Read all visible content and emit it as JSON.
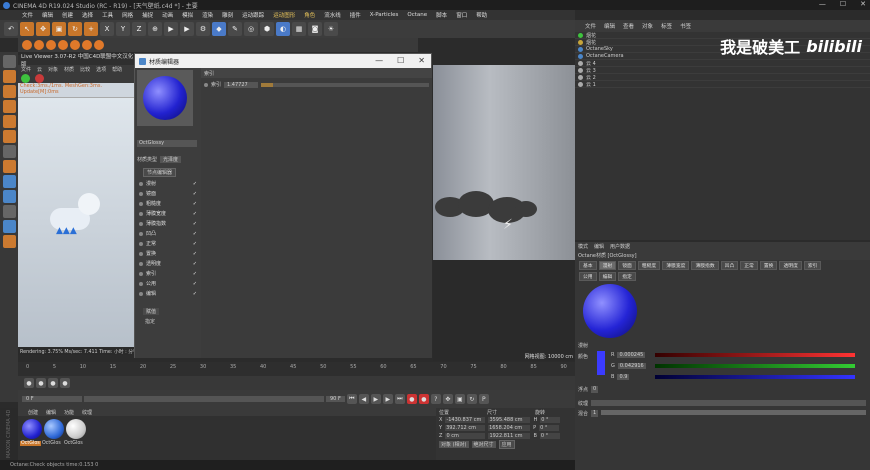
{
  "titlebar": {
    "title": "CINEMA 4D R19.024 Studio (RC - R19) - [天气壁纸.c4d *] - 主要"
  },
  "menubar": {
    "items": [
      "文件",
      "编辑",
      "创建",
      "选择",
      "工具",
      "网格",
      "捕捉",
      "动画",
      "模拟",
      "渲染",
      "雕刻",
      "运动跟踪",
      "运动图形",
      "角色",
      "流水线",
      "插件",
      "X-Particles",
      "Octane",
      "脚本",
      "窗口",
      "帮助"
    ]
  },
  "toolbar": {
    "xyz": [
      "X",
      "Y",
      "Z"
    ]
  },
  "viewer": {
    "title": "Live Viewer 3.07-R2 中国C4D联盟中文汉化版",
    "menus": [
      "文件",
      "云",
      "对象",
      "材质",
      "比较",
      "选项",
      "帮助"
    ],
    "message": "Check:3ms./1ms. MeshGen:3ms. Update[M]:0ms",
    "status": "Rendering: 3.75%   Ms/sec: 7.411   Time: 小时 : 分钟"
  },
  "render": {
    "label": "网格视图: 10000 cm"
  },
  "mat_editor": {
    "title": "材质编辑器",
    "material_name": "OctGlossy",
    "section": "索引",
    "index_label": "索引",
    "index_value": "1.47727",
    "material_type_label": "材质类型",
    "material_type_value": "光泽度",
    "node_button": "节点编辑器",
    "channels": [
      "漫射",
      "镜面",
      "粗糙度",
      "薄膜宽度",
      "薄膜指数",
      "凹凸",
      "正常",
      "置换",
      "透明度",
      "索引",
      "公用",
      "编辑"
    ],
    "assign": "赋值",
    "hint": "指定"
  },
  "objmgr": {
    "tabs": [
      "文件",
      "编辑",
      "查看",
      "对象",
      "标签",
      "书签"
    ],
    "rows": [
      {
        "name": "烟花",
        "color": "#3ec33e"
      },
      {
        "name": "烟花",
        "color": "#c7a53a"
      },
      {
        "name": "OctaneSky",
        "color": "#4b86c8"
      },
      {
        "name": "OctaneCamera",
        "color": "#4b86c8"
      },
      {
        "name": "云 4",
        "color": "#aaa"
      },
      {
        "name": "云 3",
        "color": "#aaa"
      },
      {
        "name": "云 2",
        "color": "#aaa"
      },
      {
        "name": "云 1",
        "color": "#aaa"
      }
    ],
    "logo_text": "我是破美工",
    "logo_brand": "bilibili"
  },
  "attr": {
    "tabs": [
      "模式",
      "编辑",
      "用户数据"
    ],
    "material": "Octane材质 [OctGlossy]",
    "chips_row1": [
      "基本",
      "漫射",
      "镜面",
      "粗糙度",
      "薄膜宽度",
      "薄膜指数",
      "凹凸",
      "正常",
      "置换",
      "透明度",
      "索引"
    ],
    "chips_row2": [
      "公用",
      "编辑",
      "指定"
    ],
    "section": "漫射",
    "color_label": "颜色",
    "r_label": "R",
    "r_value": "0.000245",
    "g_label": "G",
    "g_value": "0.042916",
    "b_label": "B",
    "b_value": "0.9",
    "float_label": "浮点",
    "float_value": "0",
    "texture_label": "纹理",
    "mix_label": "混合",
    "mix_value": "1"
  },
  "timeline": {
    "ticks": [
      "0",
      "5",
      "10",
      "15",
      "20",
      "25",
      "30",
      "35",
      "40",
      "45",
      "50",
      "55",
      "60",
      "65",
      "70",
      "75",
      "80",
      "85",
      "90"
    ],
    "start": "0 F",
    "end": "90 F"
  },
  "matmgr": {
    "tabs": [
      "创建",
      "编辑",
      "功能",
      "纹理"
    ],
    "materials": [
      "OctGlos",
      "OctGlos",
      "OctGlos"
    ]
  },
  "coord": {
    "headers": [
      "位置",
      "尺寸",
      "旋转"
    ],
    "rows": [
      {
        "axis": "X",
        "pos": "-1430.837 cm",
        "size": "3595.488 cm",
        "rotLabel": "H",
        "rot": "0 °"
      },
      {
        "axis": "Y",
        "pos": "392.712 cm",
        "size": "1658.204 cm",
        "rotLabel": "P",
        "rot": "0 °"
      },
      {
        "axis": "Z",
        "pos": "0 cm",
        "size": "1922.811 cm",
        "rotLabel": "B",
        "rot": "0 °"
      }
    ],
    "mode": "对象 (相对)",
    "size_mode": "绝对尺寸",
    "apply": "应用"
  },
  "watermark": "MAXON CINEMA 4D",
  "statusbar": "Octane:Check objects time:0.153  0"
}
